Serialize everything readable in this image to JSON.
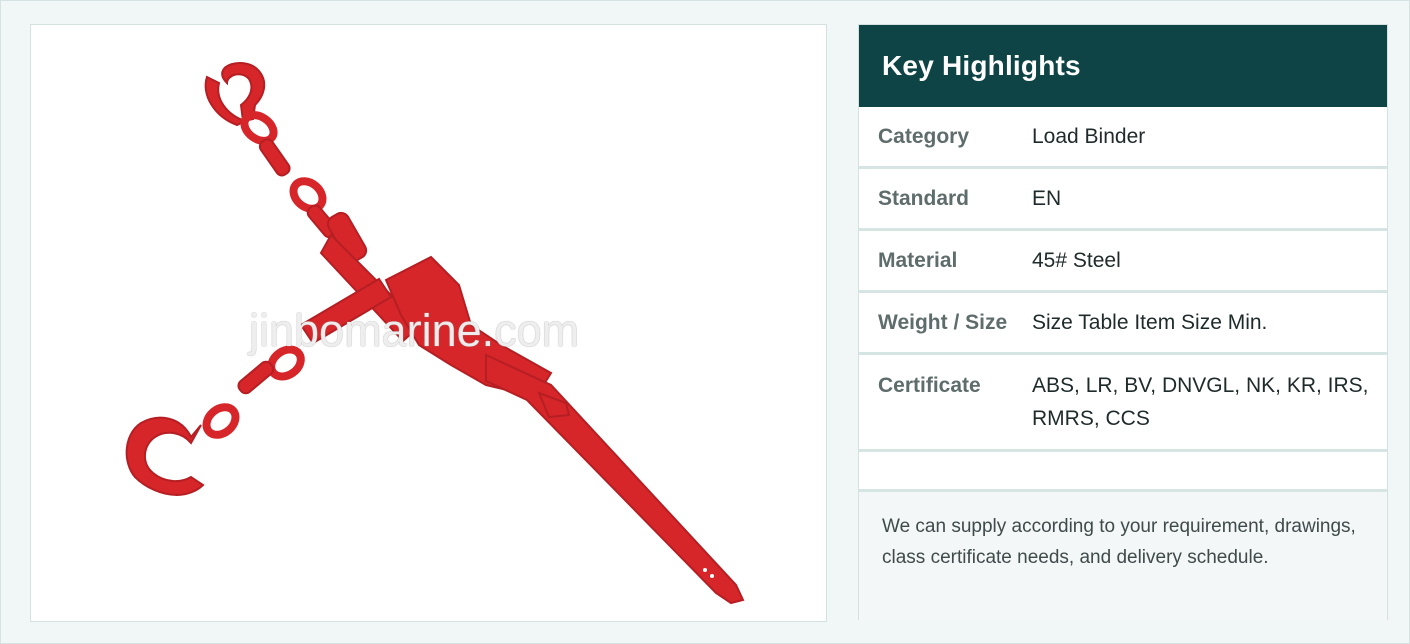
{
  "product_image": {
    "alt": "Red ratchet load binder with hooks and chains",
    "watermark": "jinbomarine.com",
    "colors": {
      "metal": "#d7262a",
      "metal_dark": "#a51d20"
    }
  },
  "highlights": {
    "title": "Key Highlights",
    "header_color": "#0e4446",
    "rows": [
      {
        "label": "Category",
        "value": "Load Binder"
      },
      {
        "label": "Standard",
        "value": "EN"
      },
      {
        "label": "Material",
        "value": "45# Steel"
      },
      {
        "label": "Weight / Size",
        "value": "Size Table Item Size Min."
      },
      {
        "label": "Certificate",
        "value": "ABS, LR, BV, DNVGL, NK, KR, IRS, RMRS, CCS"
      }
    ],
    "note": "We can supply according to your requirement, drawings, class certificate needs, and delivery schedule."
  }
}
